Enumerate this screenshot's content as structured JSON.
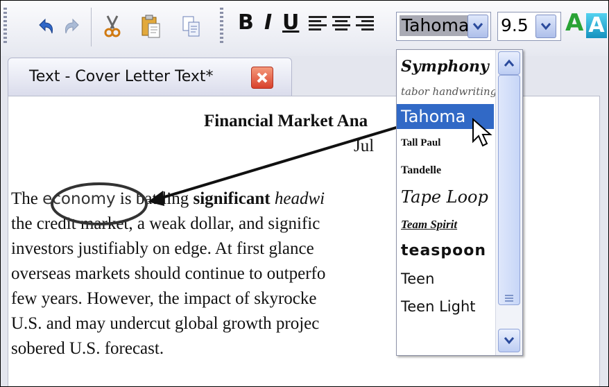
{
  "toolbar": {
    "bold_label": "B",
    "italic_label": "I",
    "underline_label": "U",
    "font_value": "Tahoma",
    "size_value": "9.5",
    "font_color_label": "A",
    "highlight_label": "A",
    "colors": {
      "accent_green": "#2aa336",
      "accent_teal": "#1fa3c9",
      "combo_border": "#7d8fc4"
    }
  },
  "tab": {
    "label": "Text - Cover Letter Text*"
  },
  "document": {
    "title": "Financial Market Ana",
    "date": "Jul",
    "lines": [
      {
        "pre": "The ",
        "highlight": "economy",
        "post": " is battling ",
        "bold": "significant",
        "italic": " headwi"
      },
      {
        "text": "the credit market, a weak dollar, and signific"
      },
      {
        "text": "investors justifiably on edge.  At first glance"
      },
      {
        "text": "overseas markets should continue to outperfo"
      },
      {
        "text": "few years.  However, the impact of skyrocke"
      },
      {
        "text": "U.S. and may undercut global growth projec"
      },
      {
        "text": "sobered U.S. forecast."
      }
    ]
  },
  "font_list": {
    "items": [
      "Symphony",
      "tabor handwriting",
      "Tahoma",
      "Tall Paul",
      "Tandelle",
      "Tape Loop",
      "Team Spirit",
      "teaspoon",
      "Teen",
      "Teen Light"
    ],
    "selected": "Tahoma",
    "selected_color": "#3169c6"
  }
}
